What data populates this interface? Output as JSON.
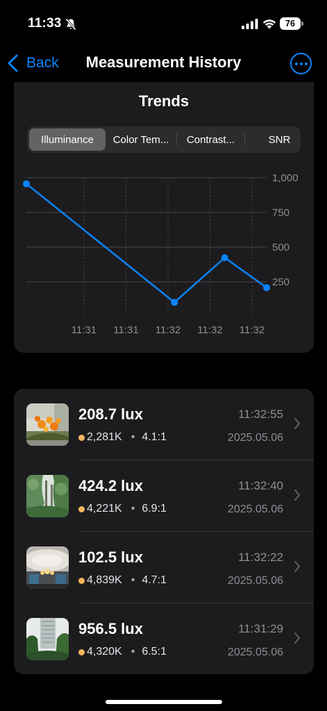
{
  "status_bar": {
    "time": "11:33",
    "battery": "76"
  },
  "nav": {
    "back_label": "Back",
    "title": "Measurement History"
  },
  "trends": {
    "title": "Trends",
    "segments": [
      "Illuminance",
      "Color Tem...",
      "Contrast...",
      "SNR"
    ],
    "selected_segment": "Illuminance"
  },
  "chart_data": {
    "type": "line",
    "title": "",
    "xlabel": "",
    "ylabel": "",
    "x_tick_labels": [
      "11:31",
      "11:31",
      "11:32",
      "11:32",
      "11:32"
    ],
    "y_tick_labels": [
      "250",
      "500",
      "750",
      "1,000"
    ],
    "ylim": [
      0,
      1000
    ],
    "y_grid": [
      250,
      500,
      750,
      1000
    ],
    "grid": true,
    "series": [
      {
        "color": "#0a84ff",
        "x": [
          "11:31:29",
          "11:32:22",
          "11:32:40",
          "11:32:55"
        ],
        "values": [
          956.5,
          102.5,
          424.2,
          208.7
        ]
      }
    ]
  },
  "measurements": [
    {
      "lux": "208.7 lux",
      "time": "11:32:55",
      "color_temp": "2,281K",
      "contrast": "4.1:1",
      "date": "2025.05.06",
      "temp_color": "#f7b55e",
      "thumb": "flowers"
    },
    {
      "lux": "424.2 lux",
      "time": "11:32:40",
      "color_temp": "4,221K",
      "contrast": "6.9:1",
      "date": "2025.05.06",
      "temp_color": "#f7b55e",
      "thumb": "trees"
    },
    {
      "lux": "102.5 lux",
      "time": "11:32:22",
      "color_temp": "4,839K",
      "contrast": "4.7:1",
      "date": "2025.05.06",
      "temp_color": "#f7b55e",
      "thumb": "ceiling-lamp"
    },
    {
      "lux": "956.5 lux",
      "time": "11:31:29",
      "color_temp": "4,320K",
      "contrast": "6.5:1",
      "date": "2025.05.06",
      "temp_color": "#f7b55e",
      "thumb": "building"
    }
  ]
}
